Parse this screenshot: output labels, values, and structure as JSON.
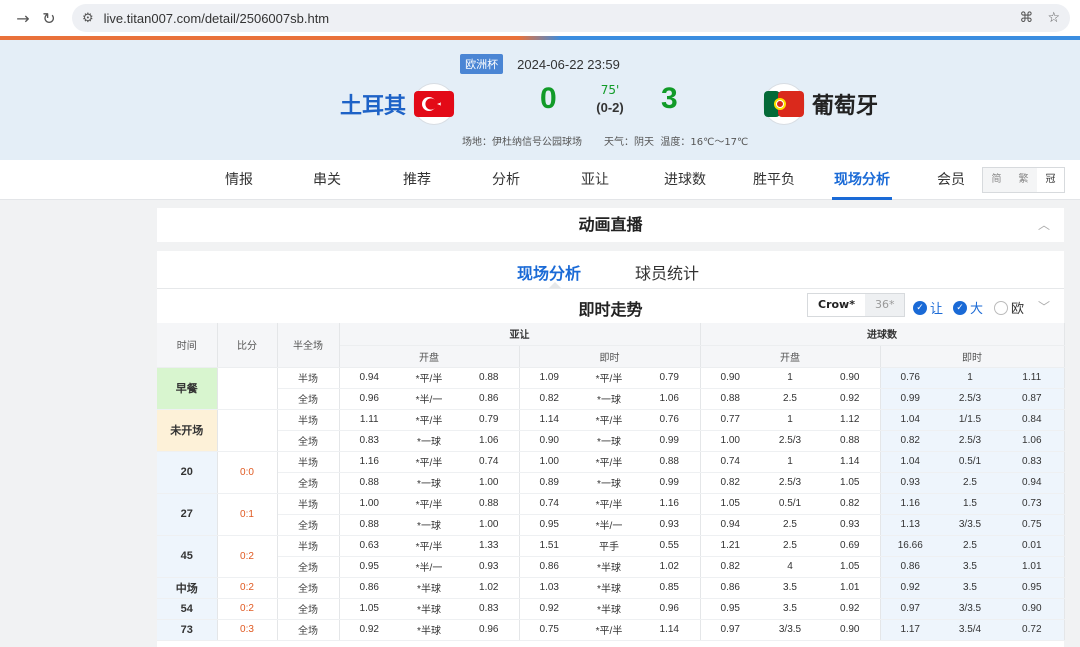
{
  "browser": {
    "url": "live.titan007.com/detail/2506007sb.htm"
  },
  "match": {
    "league": "欧洲杯",
    "datetime": "2024-06-22 23:59",
    "home_team": "土耳其",
    "away_team": "葡萄牙",
    "home_score": "0",
    "away_score": "3",
    "minute": "75'",
    "half_score": "(0-2)",
    "venue": "场地：伊杜纳信号公园球场",
    "weather": "天气：阴天",
    "temperature": "温度：16℃～17℃"
  },
  "tabs": [
    "情报",
    "串关",
    "推荐",
    "分析",
    "亚让",
    "进球数",
    "胜平负",
    "现场分析",
    "会员"
  ],
  "active_tab": "现场分析",
  "lang": [
    "简",
    "繁",
    "冠"
  ],
  "anim_panel": {
    "title": "动画直播"
  },
  "sub_tabs": [
    "现场分析",
    "球员统计"
  ],
  "trend": {
    "title": "即时走势",
    "companies": [
      "Crow*",
      "36*"
    ],
    "options": [
      {
        "label": "让",
        "checked": true
      },
      {
        "label": "大",
        "checked": true
      },
      {
        "label": "欧",
        "checked": false
      }
    ]
  },
  "table": {
    "head": {
      "time": "时间",
      "score": "比分",
      "half": "半全场",
      "asian": "亚让",
      "goals": "进球数",
      "open": "开盘",
      "live": "即时"
    },
    "rows": [
      {
        "t": "早餐",
        "s": "",
        "cls": "early",
        "h": "半场",
        "a": [
          "0.94",
          "*平/半",
          "0.88",
          "1.09",
          "*平/半",
          "0.79"
        ],
        "g": [
          "0.90",
          "1",
          "0.90",
          "0.76",
          "1",
          "1.11"
        ]
      },
      {
        "t": "",
        "s": "",
        "cls": "early",
        "h": "全场",
        "a": [
          "0.96",
          "*半/一",
          "0.86",
          "0.82",
          "*一球",
          "1.06"
        ],
        "g": [
          "0.88",
          "2.5",
          "0.92",
          "0.99",
          "2.5/3",
          "0.87"
        ]
      },
      {
        "t": "未开场",
        "s": "",
        "cls": "pre",
        "h": "半场",
        "a": [
          "1.11",
          "*平/半",
          "0.79",
          "1.14",
          "*平/半",
          "0.76"
        ],
        "g": [
          "0.77",
          "1",
          "1.12",
          "1.04",
          "1/1.5",
          "0.84"
        ]
      },
      {
        "t": "",
        "s": "",
        "cls": "pre",
        "h": "全场",
        "a": [
          "0.83",
          "*一球",
          "1.06",
          "0.90",
          "*一球",
          "0.99"
        ],
        "g": [
          "1.00",
          "2.5/3",
          "0.88",
          "0.82",
          "2.5/3",
          "1.06"
        ]
      },
      {
        "t": "20",
        "s": "0:0",
        "cls": "",
        "h": "半场",
        "a": [
          "1.16",
          "*平/半",
          "0.74",
          "1.00",
          "*平/半",
          "0.88"
        ],
        "g": [
          "0.74",
          "1",
          "1.14",
          "1.04",
          "0.5/1",
          "0.83"
        ]
      },
      {
        "t": "",
        "s": "",
        "cls": "",
        "h": "全场",
        "a": [
          "0.88",
          "*一球",
          "1.00",
          "0.89",
          "*一球",
          "0.99"
        ],
        "g": [
          "0.82",
          "2.5/3",
          "1.05",
          "0.93",
          "2.5",
          "0.94"
        ]
      },
      {
        "t": "27",
        "s": "0:1",
        "cls": "",
        "h": "半场",
        "a": [
          "1.00",
          "*平/半",
          "0.88",
          "0.74",
          "*平/半",
          "1.16"
        ],
        "g": [
          "1.05",
          "0.5/1",
          "0.82",
          "1.16",
          "1.5",
          "0.73"
        ]
      },
      {
        "t": "",
        "s": "",
        "cls": "",
        "h": "全场",
        "a": [
          "0.88",
          "*一球",
          "1.00",
          "0.95",
          "*半/一",
          "0.93"
        ],
        "g": [
          "0.94",
          "2.5",
          "0.93",
          "1.13",
          "3/3.5",
          "0.75"
        ]
      },
      {
        "t": "45",
        "s": "0:2",
        "cls": "",
        "h": "半场",
        "a": [
          "0.63",
          "*平/半",
          "1.33",
          "1.51",
          "平手",
          "0.55"
        ],
        "g": [
          "1.21",
          "2.5",
          "0.69",
          "16.66",
          "2.5",
          "0.01"
        ]
      },
      {
        "t": "",
        "s": "",
        "cls": "",
        "h": "全场",
        "a": [
          "0.95",
          "*半/一",
          "0.93",
          "0.86",
          "*半球",
          "1.02"
        ],
        "g": [
          "0.82",
          "4",
          "1.05",
          "0.86",
          "3.5",
          "1.01"
        ]
      },
      {
        "t": "中场",
        "s": "0:2",
        "cls": "",
        "h": "全场",
        "a": [
          "0.86",
          "*半球",
          "1.02",
          "1.03",
          "*半球",
          "0.85"
        ],
        "g": [
          "0.86",
          "3.5",
          "1.01",
          "0.92",
          "3.5",
          "0.95"
        ]
      },
      {
        "t": "54",
        "s": "0:2",
        "cls": "",
        "h": "全场",
        "a": [
          "1.05",
          "*半球",
          "0.83",
          "0.92",
          "*半球",
          "0.96"
        ],
        "g": [
          "0.95",
          "3.5",
          "0.92",
          "0.97",
          "3/3.5",
          "0.90"
        ]
      },
      {
        "t": "73",
        "s": "0:3",
        "cls": "",
        "h": "全场",
        "a": [
          "0.92",
          "*半球",
          "0.96",
          "0.75",
          "*平/半",
          "1.14"
        ],
        "g": [
          "0.97",
          "3/3.5",
          "0.90",
          "1.17",
          "3.5/4",
          "0.72"
        ]
      }
    ]
  }
}
